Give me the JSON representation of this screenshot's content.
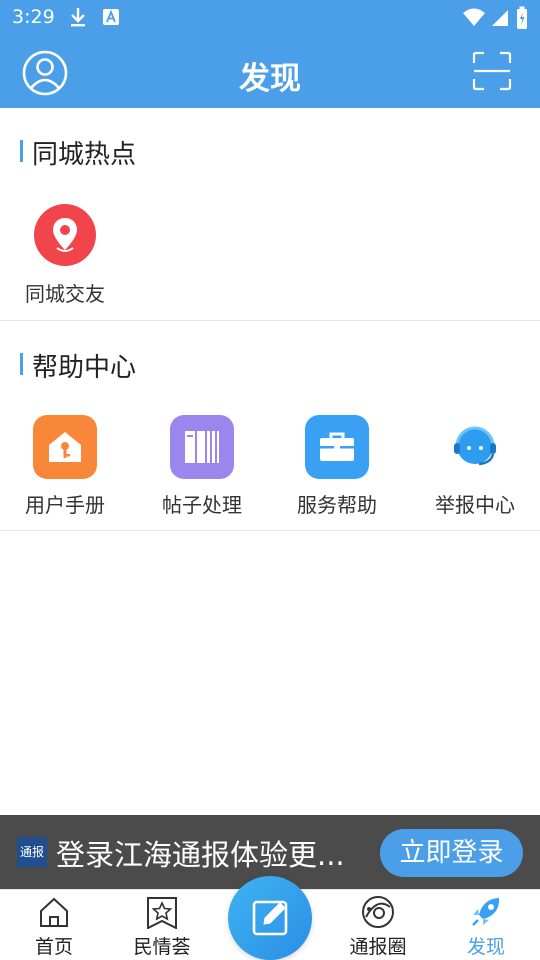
{
  "status_bar": {
    "time": "3:29",
    "icons": [
      "download-icon",
      "font-icon",
      "wifi-icon",
      "signal-icon",
      "battery-icon"
    ]
  },
  "app_bar": {
    "title": "发现",
    "left_icon": "user-avatar-icon",
    "right_icon": "scan-icon"
  },
  "sections": [
    {
      "title": "同城热点",
      "items": [
        {
          "label": "同城交友",
          "icon": "location-pin-icon",
          "color": "#f2454b"
        }
      ]
    },
    {
      "title": "帮助中心",
      "items": [
        {
          "label": "用户手册",
          "icon": "home-key-icon",
          "color": "#f8873a"
        },
        {
          "label": "帖子处理",
          "icon": "books-icon",
          "color": "#9b86ee"
        },
        {
          "label": "服务帮助",
          "icon": "briefcase-icon",
          "color": "#3aa0f3"
        },
        {
          "label": "举报中心",
          "icon": "headset-icon",
          "color": "#2d9df0"
        }
      ]
    }
  ],
  "login_banner": {
    "logo_text": "通报",
    "message": "登录江海通报体验更...",
    "button_label": "立即登录"
  },
  "tab_bar": {
    "tabs": [
      {
        "label": "首页",
        "icon": "home-icon",
        "active": false
      },
      {
        "label": "民情荟",
        "icon": "star-bookmark-icon",
        "active": false
      },
      {
        "label": "通报圈",
        "icon": "orbit-icon",
        "active": false
      },
      {
        "label": "发现",
        "icon": "rocket-icon",
        "active": true
      }
    ],
    "center_button_icon": "edit-icon"
  },
  "colors": {
    "primary": "#4a9fe8",
    "banner_bg": "#3c3c3c"
  }
}
